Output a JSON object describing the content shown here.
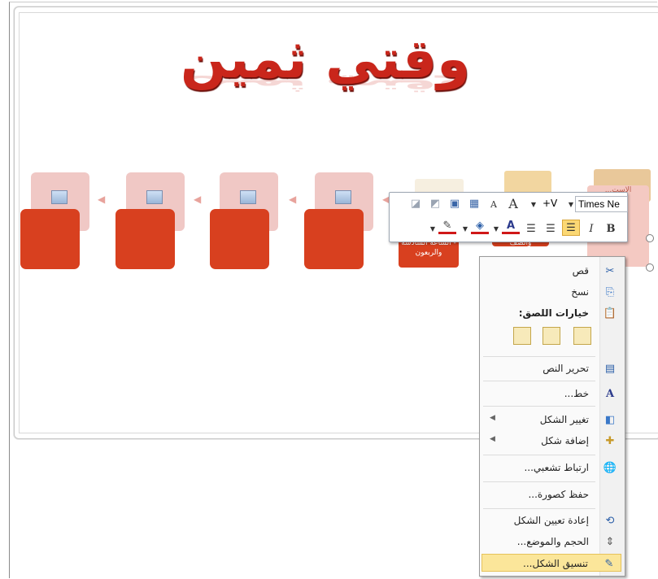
{
  "slide": {
    "title": "وقتي ثمين"
  },
  "smartart": {
    "captions": [
      "الإست...",
      "والضف",
      "- الساعة السادسة والربعون"
    ]
  },
  "minitoolbar": {
    "font_name": "Times Ne",
    "font_size": "+V",
    "grow_font": "A",
    "shrink_font": "A",
    "bold": "B",
    "italic": "I",
    "font_color": "A"
  },
  "context_menu": {
    "items": [
      {
        "label": "قص",
        "icon": "scissors-icon"
      },
      {
        "label": "نسخ",
        "icon": "copy-icon"
      },
      {
        "label": "خيارات اللصق:",
        "icon": "paste-icon"
      },
      {
        "label": "تحرير النص",
        "icon": "edit-text-icon"
      },
      {
        "label": "خط...",
        "icon": "font-icon"
      },
      {
        "label": "تغيير الشكل",
        "icon": "change-shape-icon"
      },
      {
        "label": "إضافة شكل",
        "icon": "add-shape-icon"
      },
      {
        "label": "ارتباط تشعبي...",
        "icon": "hyperlink-icon"
      },
      {
        "label": "حفظ كصورة...",
        "icon": ""
      },
      {
        "label": "إعادة تعيين الشكل",
        "icon": "reset-shape-icon"
      },
      {
        "label": "الحجم والموضع...",
        "icon": "size-position-icon"
      },
      {
        "label": "تنسيق الشكل...",
        "icon": "format-shape-icon"
      }
    ]
  },
  "colors": {
    "accent": "#d8401f",
    "title": "#c9261b",
    "menu_highlight": "#fbe69a"
  }
}
